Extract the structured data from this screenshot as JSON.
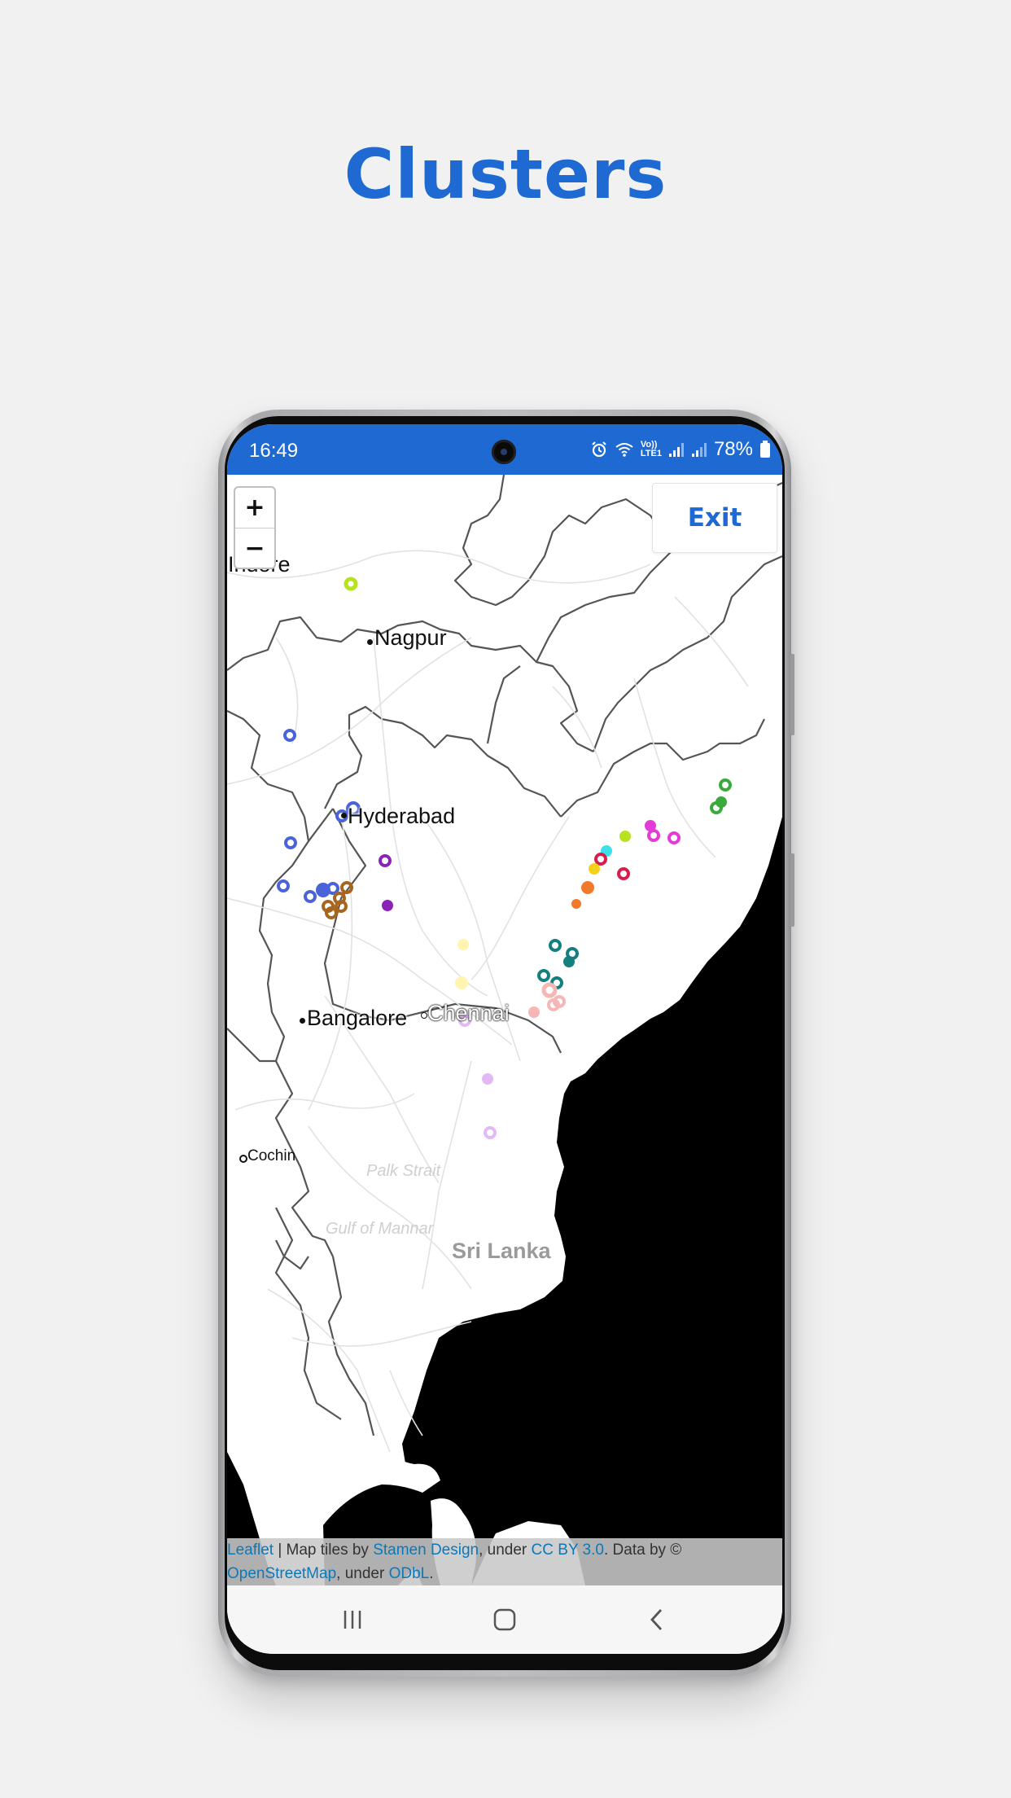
{
  "page": {
    "headline": "Clusters"
  },
  "status_bar": {
    "time": "16:49",
    "battery": "78%",
    "icons": [
      "alarm-icon",
      "wifi-icon",
      "volte-icon",
      "signal-icon",
      "signal-icon",
      "battery-icon"
    ],
    "volte_label_top": "Vo))",
    "volte_label_bottom": "LTE1"
  },
  "map": {
    "zoom_in_label": "+",
    "zoom_out_label": "−",
    "exit_label": "Exit",
    "labels": {
      "indore": "Indore",
      "nagpur": "Nagpur",
      "hyderabad": "Hyderabad",
      "bangalore": "Bangalore",
      "chennai": "Chennai",
      "cochin": "Cochin",
      "palk_strait": "Palk Strait",
      "gulf_of_mannar": "Gulf of Mannar",
      "sri_lanka": "Sri Lanka"
    },
    "attribution": {
      "leaflet": "Leaflet",
      "sep": " | Map tiles by ",
      "stamen": "Stamen Design",
      "under1": ", under ",
      "ccby": "CC BY 3.0",
      "data_by": ". Data by ©",
      "osm": "OpenStreetMap",
      "under2": ", under ",
      "odbl": "ODbL",
      "end": "."
    },
    "cluster_colors": {
      "lime": "#b6e21f",
      "blue": "#4a63d8",
      "green": "#3aab3a",
      "magenta": "#e43ad8",
      "purple": "#8a24b8",
      "crimson": "#d81e4e",
      "cyan": "#3ce0e8",
      "yellow": "#f5d21a",
      "orange": "#f07a2a",
      "brown": "#a8651e",
      "teal": "#147f7f",
      "cream": "#fff5b0",
      "pink": "#f7b6b6",
      "lavender": "#e2b8f5"
    }
  },
  "nav_bar": {
    "icons": [
      "recents-icon",
      "home-icon",
      "back-icon"
    ]
  }
}
